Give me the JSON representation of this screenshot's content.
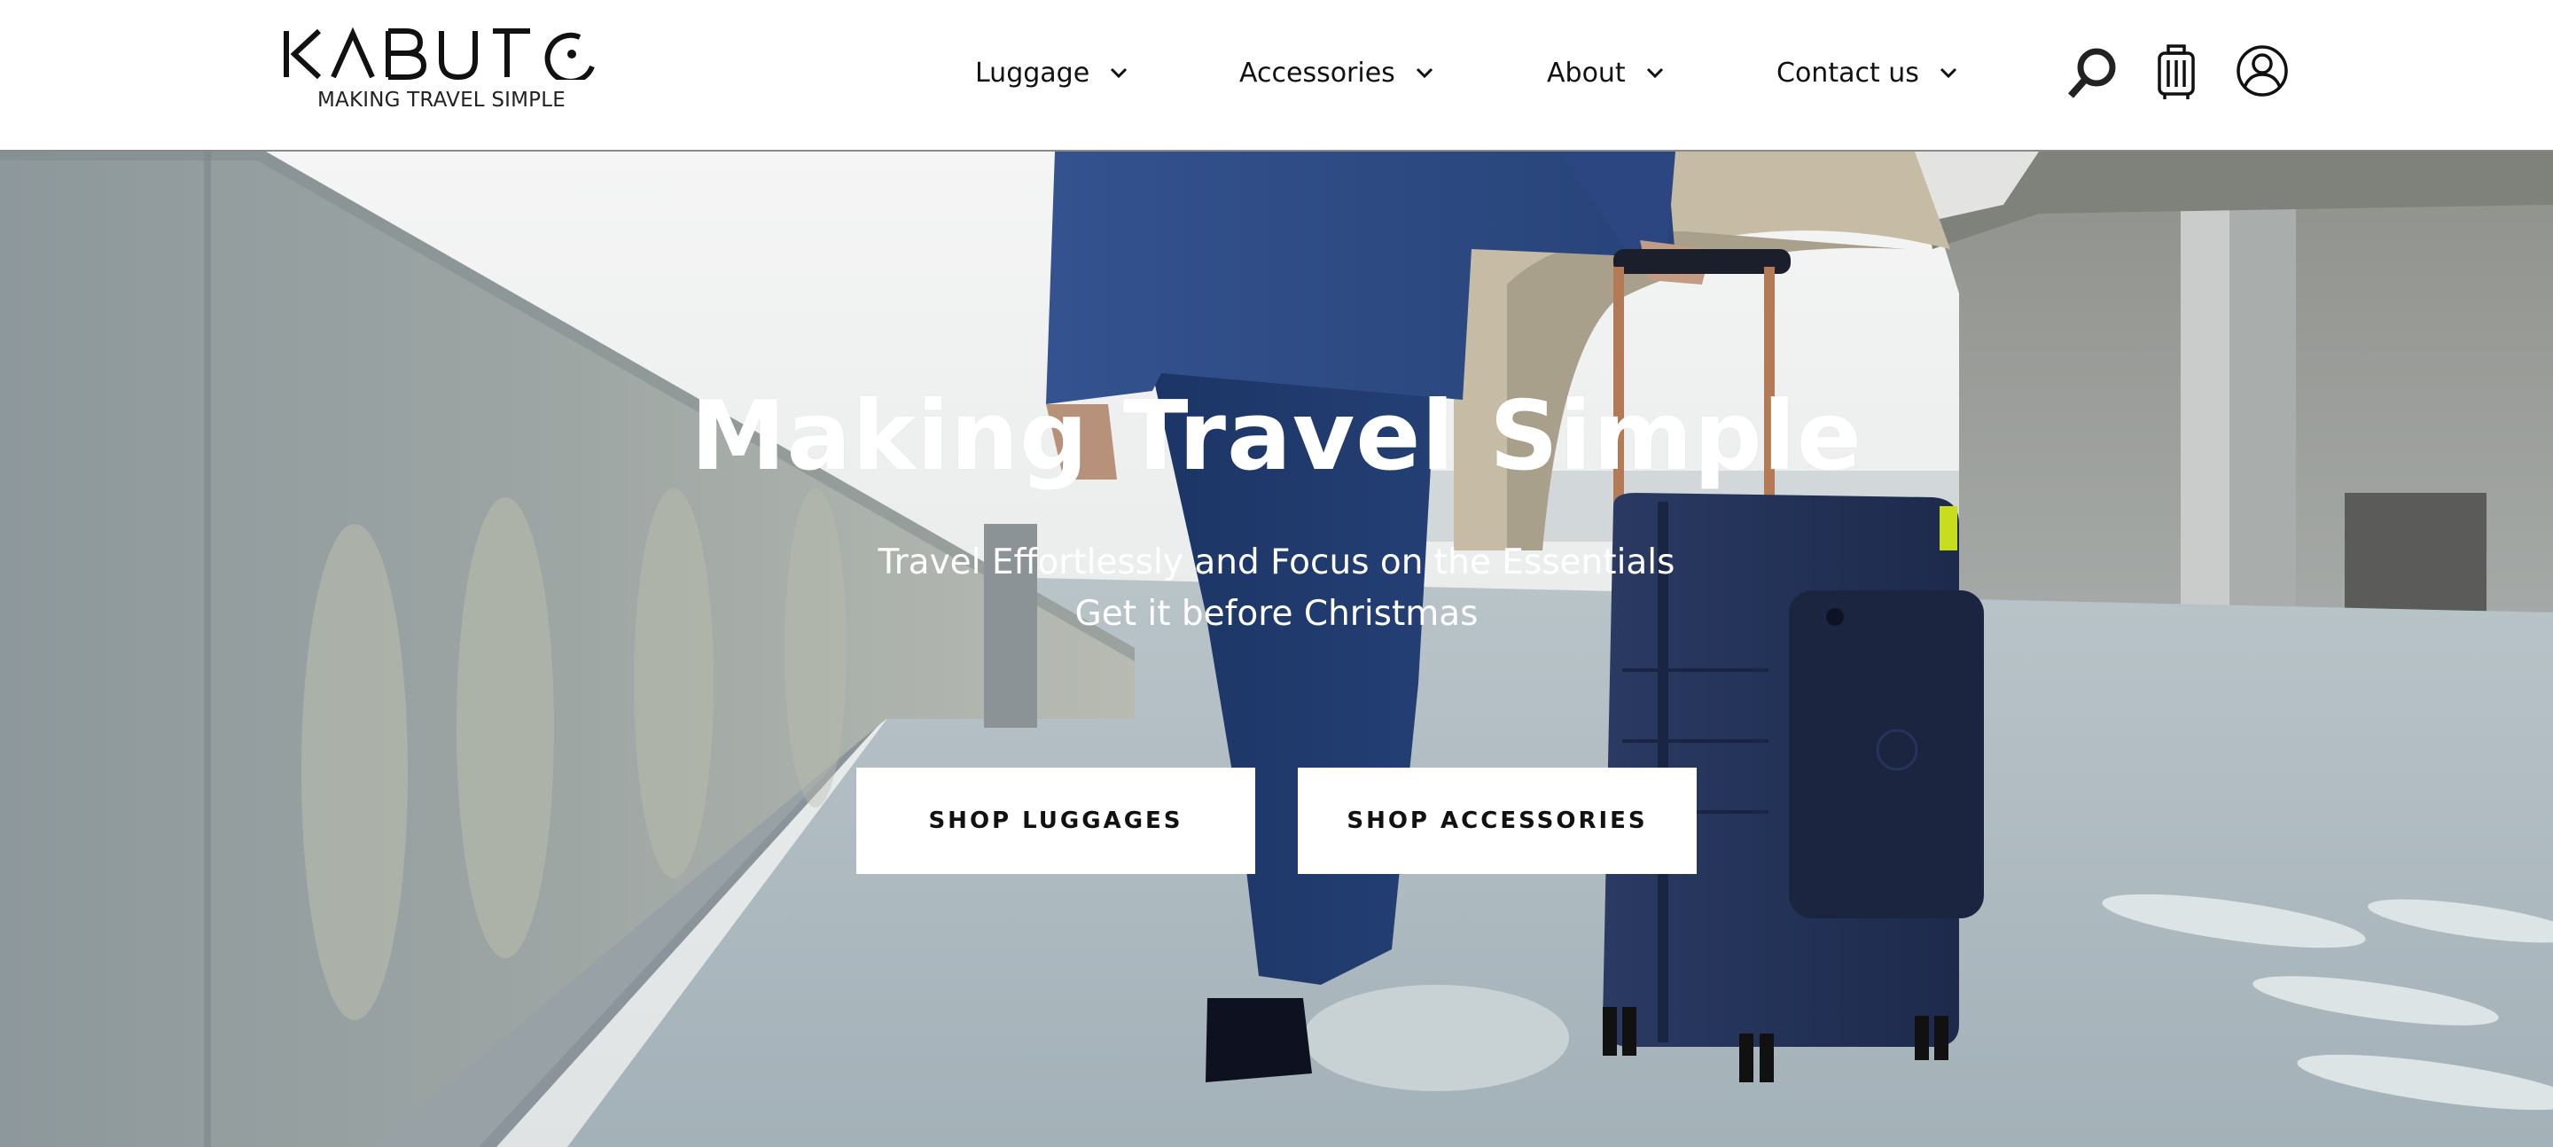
{
  "brand": {
    "name": "KABUTO",
    "tagline": "MAKING TRAVEL SIMPLE"
  },
  "nav": {
    "items": [
      {
        "label": "Luggage",
        "icon": "chevron-down-icon"
      },
      {
        "label": "Accessories",
        "icon": "chevron-down-icon"
      },
      {
        "label": "About",
        "icon": "chevron-down-icon"
      },
      {
        "label": "Contact us",
        "icon": "chevron-down-icon"
      }
    ],
    "actions": [
      {
        "name": "search",
        "icon": "search-icon"
      },
      {
        "name": "cart",
        "icon": "suitcase-icon"
      },
      {
        "name": "account",
        "icon": "user-circle-icon"
      }
    ]
  },
  "hero": {
    "title": "Making Travel Simple",
    "subtitle_line1": "Travel Effortlessly and Focus on the Essentials",
    "subtitle_line2": "Get it before Christmas",
    "buttons": {
      "shop_luggages": "SHOP LUGGAGES",
      "shop_accessories": "SHOP ACCESSORIES"
    },
    "image_description": "Man in navy blazer and jeans walking along a concrete walkway pulling a navy hard-shell suitcase with front pocket and copper trolley handle",
    "colors": {
      "suitcase": "#1f2f55",
      "blazer": "#2e4a86",
      "concrete": "#9aa5ab",
      "sky": "#eef0f0"
    }
  },
  "colors": {
    "text_dark": "#111111",
    "header_bg": "#ffffff",
    "header_border": "#8a8a8a",
    "button_bg": "#ffffff"
  }
}
